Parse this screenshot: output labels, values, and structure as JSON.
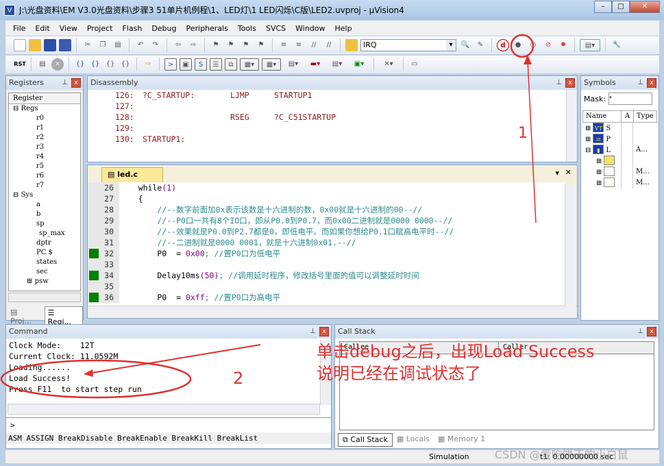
{
  "window": {
    "title": "J:\\光盘资料\\EM V3.0光盘资料\\步骤3 51单片机例程\\1、LED灯\\1 LED闪烁\\C版\\LED2.uvproj - µVision4",
    "buttons": [
      "–",
      "□",
      "✕"
    ]
  },
  "menu": [
    "File",
    "Edit",
    "View",
    "Project",
    "Flash",
    "Debug",
    "Peripherals",
    "Tools",
    "SVCS",
    "Window",
    "Help"
  ],
  "toolbar": {
    "combo_value": "IRQ",
    "debug_button": "start-stop-debug",
    "rst_label": "RST"
  },
  "registers": {
    "title": "Registers",
    "header": "Register",
    "groups": [
      {
        "name": "Regs",
        "items": [
          "r0",
          "r1",
          "r2",
          "r3",
          "r4",
          "r5",
          "r6",
          "r7"
        ]
      },
      {
        "name": "Sys",
        "items": [
          "a",
          "b",
          "sp",
          "sp_max",
          "dptr",
          "PC  $",
          "states",
          "sec",
          "psw"
        ]
      }
    ],
    "tabs": [
      "Proj...",
      "Regi..."
    ]
  },
  "disassembly": {
    "title": "Disassembly",
    "lines": [
      {
        "num": "126:",
        "label": "?C_STARTUP:",
        "op": "LJMP",
        "arg": "STARTUP1"
      },
      {
        "num": "127:",
        "label": "",
        "op": "",
        "arg": ""
      },
      {
        "num": "128:",
        "label": "",
        "op": "RSEG",
        "arg": "?C_C51STARTUP"
      },
      {
        "num": "129:",
        "label": "",
        "op": "",
        "arg": ""
      },
      {
        "num": "130:",
        "label": "STARTUP1:",
        "op": "",
        "arg": ""
      }
    ]
  },
  "editor": {
    "tab": "led.c",
    "lines": [
      {
        "n": "26",
        "bp": false,
        "code": "    while",
        "num": "(1)",
        "cm": ""
      },
      {
        "n": "27",
        "bp": false,
        "code": "    {",
        "num": "",
        "cm": ""
      },
      {
        "n": "28",
        "bp": false,
        "code": "        ",
        "num": "",
        "cm": "//--数字前面加0x表示该数是十六进制的数，0x00就是十六进制的00--//"
      },
      {
        "n": "29",
        "bp": false,
        "code": "        ",
        "num": "",
        "cm": "//--P0口一共有8个IO口，即从P0.0到P0.7，而0x00二进制就是0000 0000--//"
      },
      {
        "n": "30",
        "bp": false,
        "code": "        ",
        "num": "",
        "cm": "//--效果就是P0.0到P2.7都是0，即低电平。而如果你想给P0.1口赋高电平时--//"
      },
      {
        "n": "31",
        "bp": false,
        "code": "        ",
        "num": "",
        "cm": "//--二进制就是0000 0001，就是十六进制0x01.--//"
      },
      {
        "n": "32",
        "bp": true,
        "code": "        P0  = ",
        "num": "0x00",
        "cm": "; //置P0口为低电平"
      },
      {
        "n": "33",
        "bp": false,
        "code": "",
        "num": "",
        "cm": ""
      },
      {
        "n": "34",
        "bp": true,
        "code": "        Delay10ms",
        "num": "(50)",
        "cm": "; //调用延时程序，修改括号里面的值可以调整延时时间"
      },
      {
        "n": "35",
        "bp": false,
        "code": "",
        "num": "",
        "cm": ""
      },
      {
        "n": "36",
        "bp": true,
        "code": "        P0  = ",
        "num": "0xff",
        "cm": "; //置P0口为高电平"
      }
    ]
  },
  "symbols": {
    "title": "Symbols",
    "mask_label": "Mask:",
    "mask_value": "*",
    "columns": [
      "Name",
      "A",
      "Type"
    ],
    "rows": [
      {
        "name": "S",
        "type": ""
      },
      {
        "name": "P",
        "type": ""
      },
      {
        "name": "L",
        "type": "A..."
      },
      {
        "name": "",
        "type": ""
      },
      {
        "name": "",
        "type": "M..."
      },
      {
        "name": "",
        "type": "M..."
      }
    ]
  },
  "command": {
    "title": "Command",
    "output": [
      "Clock Mode:    12T",
      "Current Clock: 11.0592M",
      "Loading......",
      "Load Success!",
      "Press F11  to start step run"
    ],
    "prompt": ">",
    "hints": "ASM ASSIGN BreakDisable BreakEnable BreakKill BreakList"
  },
  "callstack": {
    "title": "Call Stack",
    "columns": [
      "Callee",
      "Caller"
    ],
    "tabs": [
      "Call Stack",
      "Locals",
      "Memory 1"
    ]
  },
  "status": {
    "mode": "Simulation",
    "time": "t1: 0.00000000 sec"
  },
  "annotations": {
    "one": "1",
    "two": "2",
    "note_line1": "单击debug之后，出现Load Success",
    "note_line2": "说明已经在调试状态了",
    "color": "#e03030"
  },
  "watermark": "CSDN @爱吃饼干的小白鼠"
}
